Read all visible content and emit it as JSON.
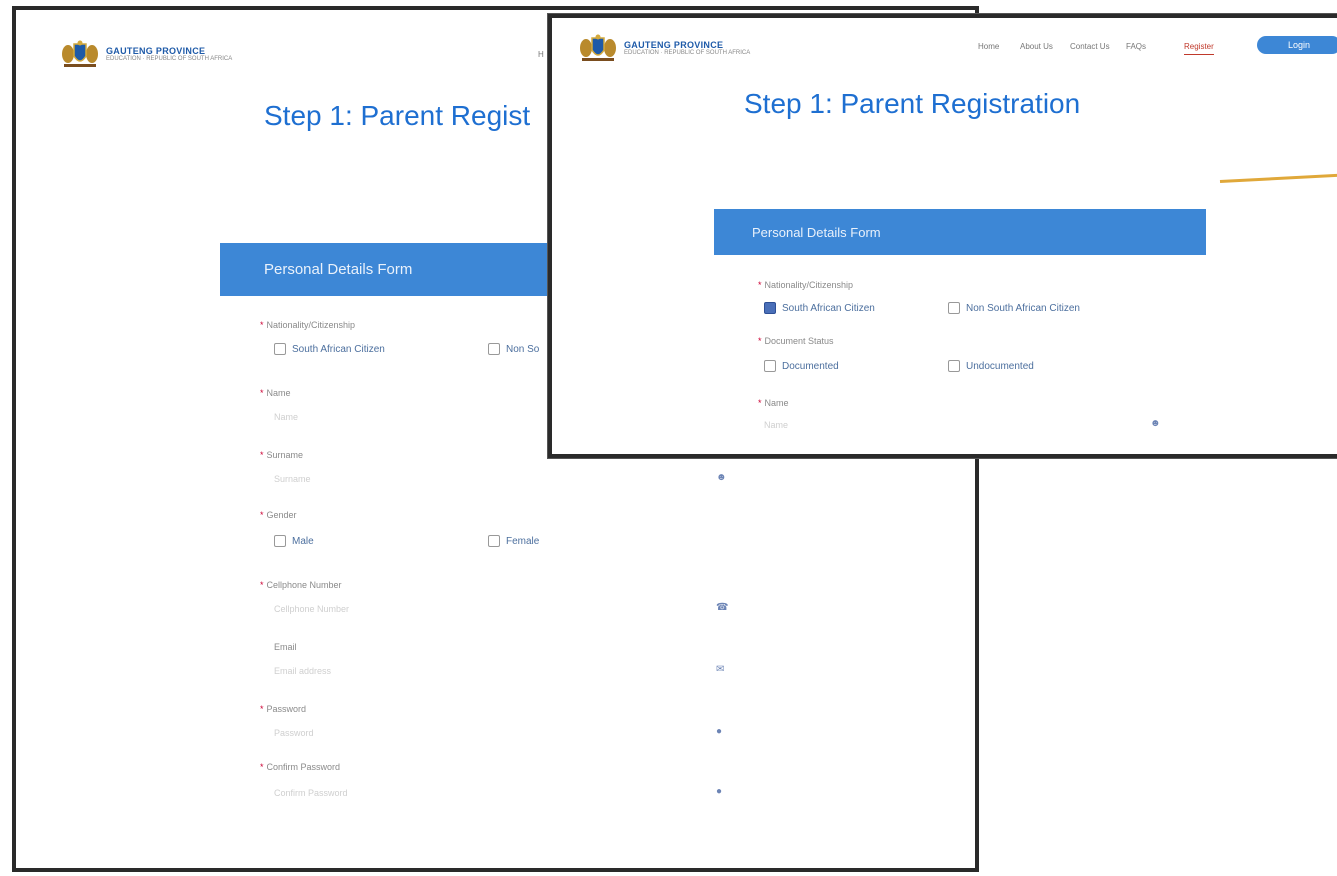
{
  "brand": {
    "name": "GAUTENG PROVINCE",
    "subtitle": "EDUCATION · REPUBLIC OF SOUTH AFRICA"
  },
  "back": {
    "nav_fragment": "H",
    "title": "Step 1: Parent Regist",
    "form_header": "Personal Details Form",
    "nationality": {
      "label": "Nationality/Citizenship",
      "opt1": "South African Citizen",
      "opt2": "Non So"
    },
    "name": {
      "label": "Name",
      "placeholder": "Name"
    },
    "surname": {
      "label": "Surname",
      "placeholder": "Surname"
    },
    "gender": {
      "label": "Gender",
      "opt1": "Male",
      "opt2": "Female"
    },
    "cellphone": {
      "label": "Cellphone Number",
      "placeholder": "Cellphone Number"
    },
    "email": {
      "label": "Email",
      "placeholder": "Email address"
    },
    "password": {
      "label": "Password",
      "placeholder": "Password"
    },
    "confirm": {
      "label": "Confirm Password",
      "placeholder": "Confirm Password"
    }
  },
  "front": {
    "nav": {
      "home": "Home",
      "about": "About Us",
      "contact": "Contact Us",
      "faqs": "FAQs",
      "register": "Register",
      "login": "Login"
    },
    "title": "Step 1: Parent Registration",
    "form_header": "Personal Details Form",
    "nationality": {
      "label": "Nationality/Citizenship",
      "opt1": "South African Citizen",
      "opt2": "Non South African Citizen"
    },
    "document": {
      "label": "Document Status",
      "opt1": "Documented",
      "opt2": "Undocumented"
    },
    "name": {
      "label": "Name",
      "placeholder": "Name"
    }
  },
  "icons": {
    "person": "person-icon",
    "phone": "phone-icon",
    "mail": "mail-icon",
    "lock": "lock-icon"
  },
  "colors": {
    "accent": "#1e6fd1",
    "form_header": "#3d87d6",
    "active_nav": "#c0392b",
    "underline": "#e0a83a"
  }
}
